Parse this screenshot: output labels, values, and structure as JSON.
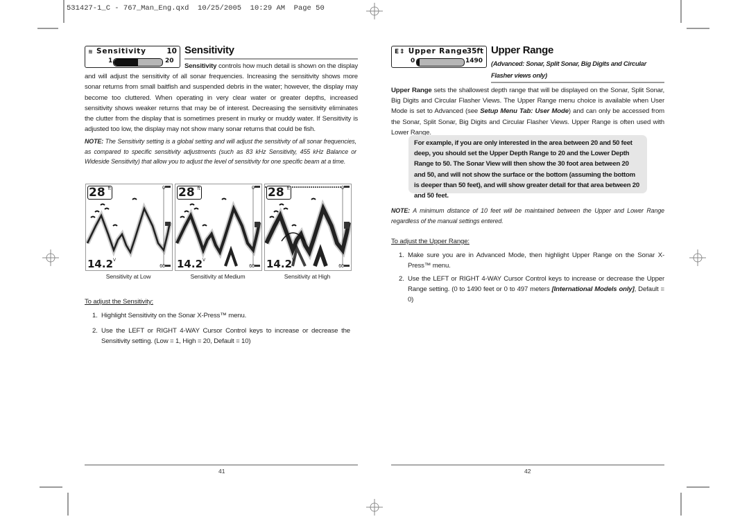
{
  "slug": "531427-1_C - 767_Man_Eng.qxd  10/25/2005  10:29 AM  Page 50",
  "left_page": {
    "menu_widget": {
      "icon": "sensitivity-icon",
      "label": "Sensitivity",
      "value": "10",
      "min": "1",
      "max": "20",
      "fill_fraction": 0.5
    },
    "heading": "Sensitivity",
    "intro_bold": "Sensitivity",
    "intro_rest": " controls how much detail is shown on the display and will adjust the sensitivity of all sonar frequencies. Increasing the sensitivity shows more sonar returns from small baitfish and suspended debris in the water; however, the display may become too cluttered. When operating in very clear water or greater depths, increased sensitivity shows weaker returns that may be of interest. Decreasing the sensitivity eliminates the clutter from the display that is sometimes present in murky or muddy water. If Sensitivity is adjusted too low, the display may not show many sonar returns that could be fish.",
    "note_label": "NOTE:",
    "note_text": " The Sensitivity setting is a global setting and will adjust the sensitivity of all sonar frequencies, as compared to specific sensitivity adjustments (such as 83 kHz Sensitivity, 455 kHz Balance or Wideside Sensitivity) that allow you to adjust the level of sensitivity for one specific beam at a time.",
    "figures": [
      {
        "depth": "28",
        "depth_unit": "ft",
        "voltage": "14.2",
        "voltage_unit": "V",
        "scale_top": "0",
        "scale_bottom": "60",
        "caption": "Sensitivity at Low",
        "level": "low"
      },
      {
        "depth": "28",
        "depth_unit": "ft",
        "voltage": "14.2",
        "voltage_unit": "V",
        "scale_top": "0",
        "scale_bottom": "60",
        "caption": "Sensitivity at Medium",
        "level": "medium"
      },
      {
        "depth": "28",
        "depth_unit": "ft",
        "voltage": "14.2",
        "voltage_unit": "V",
        "scale_top": "0",
        "scale_bottom": "60",
        "caption": "Sensitivity at High",
        "level": "high"
      }
    ],
    "procedure_title": "To adjust the Sensitivity:",
    "steps": [
      {
        "num": "1.",
        "text": "Highlight Sensitivity on the Sonar X-Press™ menu."
      },
      {
        "num": "2.",
        "text": "Use the LEFT or RIGHT 4-WAY Cursor Control keys to increase or decrease the Sensitivity setting. (Low = 1, High = 20, Default = 10)"
      }
    ],
    "page_number": "41"
  },
  "right_page": {
    "menu_widget": {
      "icon": "advanced-updown-icon",
      "label": "Upper Range",
      "value": "35ft",
      "min": "0",
      "max": "1490",
      "fill_fraction": 0.0
    },
    "heading": "Upper Range",
    "subheading": "(Advanced: Sonar, Split Sonar, Big Digits and Circular Flasher views only)",
    "intro_bold": "Upper Range",
    "intro_part1": " sets the shallowest depth range that will be displayed on the Sonar, Split Sonar, Big Digits and Circular Flasher Views. The Upper Range menu choice is available when User Mode is set to Advanced (see ",
    "intro_ref": "Setup Menu Tab: User Mode",
    "intro_part2": ") and can only be accessed from the Sonar, Split Sonar, Big Digits and Circular Flasher Views. Upper Range is often used with Lower Range.",
    "callout": "For example, if you are only interested in the area between 20 and 50 feet deep, you should set the Upper Depth Range to 20 and the Lower Depth Range to 50. The Sonar View will then show the 30 foot area between 20 and 50, and will not show the surface or the bottom (assuming the bottom is deeper than 50 feet), and will show greater detail for that area between 20 and 50 feet.",
    "note_label": "NOTE:",
    "note_text": " A minimum distance of 10 feet will be maintained between the Upper and Lower Range regardless of the manual settings entered.",
    "procedure_title": "To adjust the Upper Range:",
    "steps": [
      {
        "num": "1.",
        "text": "Make sure you are in Advanced Mode, then highlight Upper Range on the Sonar X-Press™ menu."
      },
      {
        "num": "2.",
        "text_part1": "Use the LEFT or RIGHT 4-WAY Cursor Control keys to increase or decrease the Upper Range setting. (0 to 1490 feet or 0 to 497 meters ",
        "text_em": "[International Models only]",
        "text_part2": ", Default = 0)"
      }
    ],
    "page_number": "42"
  }
}
